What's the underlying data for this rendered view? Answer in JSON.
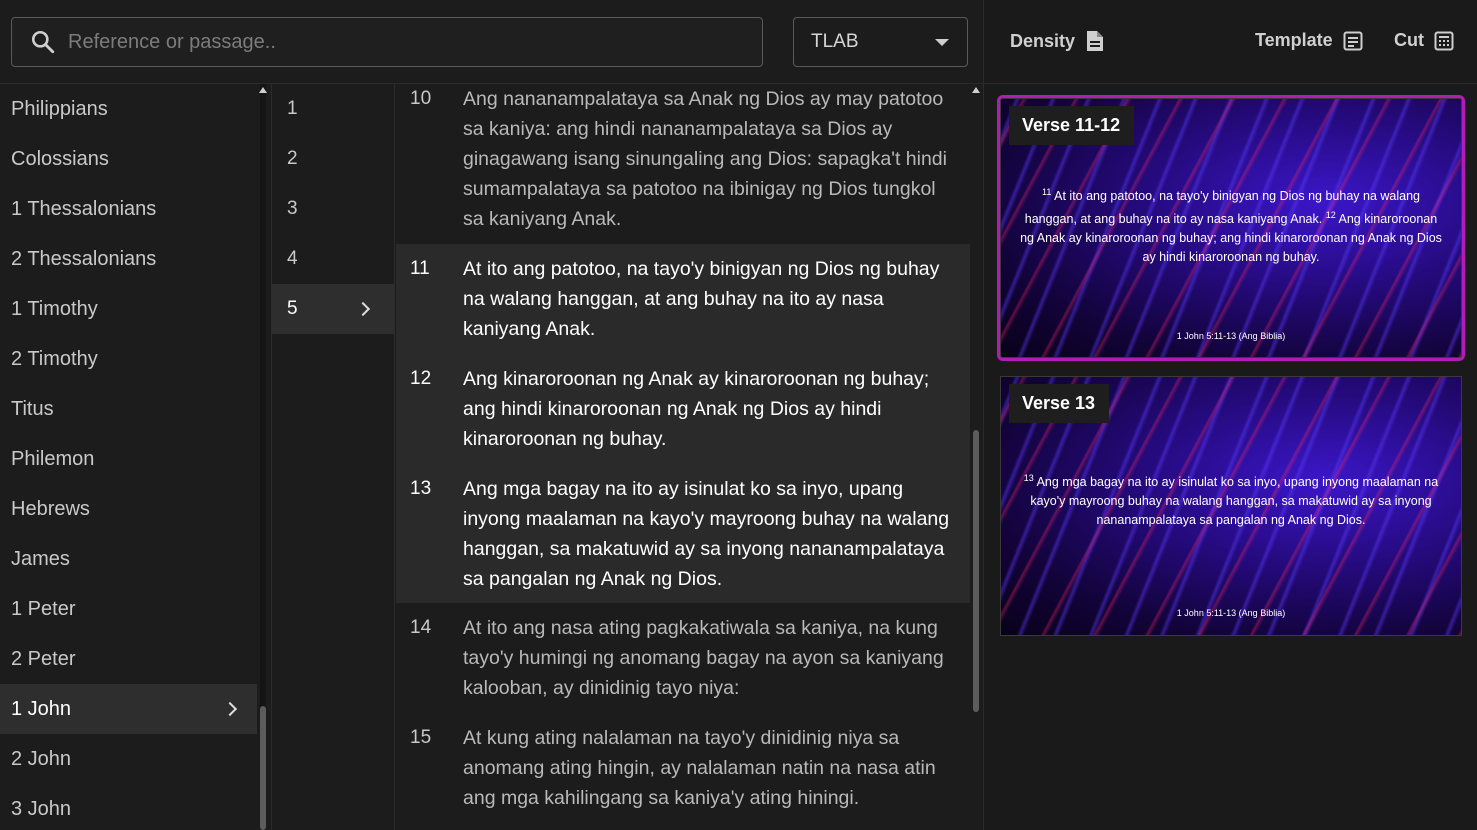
{
  "search": {
    "placeholder": "Reference or passage.."
  },
  "version": {
    "selected": "TLAB"
  },
  "books": [
    {
      "label": "Philippians"
    },
    {
      "label": "Colossians"
    },
    {
      "label": "1 Thessalonians"
    },
    {
      "label": "2 Thessalonians"
    },
    {
      "label": "1 Timothy"
    },
    {
      "label": "2 Timothy"
    },
    {
      "label": "Titus"
    },
    {
      "label": "Philemon"
    },
    {
      "label": "Hebrews"
    },
    {
      "label": "James"
    },
    {
      "label": "1 Peter"
    },
    {
      "label": "2 Peter"
    },
    {
      "label": "1 John",
      "selected": true
    },
    {
      "label": "2 John"
    },
    {
      "label": "3 John"
    }
  ],
  "chapters": [
    {
      "label": "1"
    },
    {
      "label": "2"
    },
    {
      "label": "3"
    },
    {
      "label": "4"
    },
    {
      "label": "5",
      "selected": true
    }
  ],
  "verses": [
    {
      "num": "10",
      "text": "Ang nananampalataya sa Anak ng Dios ay may patotoo sa kaniya: ang hindi nananampalataya sa Dios ay ginagawang isang sinungaling ang Dios: sapagka't hindi sumampalataya sa patotoo na ibinigay ng Dios tungkol sa kaniyang Anak."
    },
    {
      "num": "11",
      "text": "At ito ang patotoo, na tayo'y binigyan ng Dios ng buhay na walang hanggan, at ang buhay na ito ay nasa kaniyang Anak.",
      "selected": true
    },
    {
      "num": "12",
      "text": "Ang kinaroroonan ng Anak ay kinaroroonan ng buhay; ang hindi kinaroroonan ng Anak ng Dios ay hindi kinaroroonan ng buhay.",
      "selected": true
    },
    {
      "num": "13",
      "text": "Ang mga bagay na ito ay isinulat ko sa inyo, upang inyong maalaman na kayo'y mayroong buhay na walang hanggan, sa makatuwid ay sa inyong nananampalataya sa pangalan ng Anak ng Dios.",
      "selected": true
    },
    {
      "num": "14",
      "text": "At ito ang nasa ating pagkakatiwala sa kaniya, na kung tayo'y humingi ng anomang bagay na ayon sa kaniyang kalooban, ay dinidinig tayo niya:"
    },
    {
      "num": "15",
      "text": "At kung ating nalalaman na tayo'y dinidinig niya sa anomang ating hingin, ay nalalaman natin na nasa atin ang mga kahilingang sa kaniya'y ating hiningi."
    }
  ],
  "toolbar": {
    "density_label": "Density",
    "template_label": "Template",
    "cut_label": "Cut"
  },
  "slides": [
    {
      "label": "Verse 11-12",
      "sup1": "11",
      "part1": " At ito ang patotoo, na tayo'y binigyan ng Dios ng buhay na walang hanggan, at ang buhay na ito ay nasa kaniyang Anak. ",
      "sup2": "12",
      "part2": " Ang kinaroroonan ng Anak ay kinaroroonan ng buhay; ang hindi kinaroroonan ng Anak ng Dios ay hindi kinaroroonan ng buhay.",
      "reference": "1 John 5:11-13 (Ang Biblia)"
    },
    {
      "label": "Verse 13",
      "sup1": "13",
      "part1": " Ang mga bagay na ito ay isinulat ko sa inyo, upang inyong maalaman na kayo'y mayroong buhay na walang hanggan, sa makatuwid ay sa inyong nananampalataya sa pangalan ng Anak ng Dios.",
      "reference": "1 John 5:11-13 (Ang Biblia)"
    }
  ],
  "colors": {
    "accent": "#a31fa8",
    "selected_bg": "#2e2e2e"
  }
}
